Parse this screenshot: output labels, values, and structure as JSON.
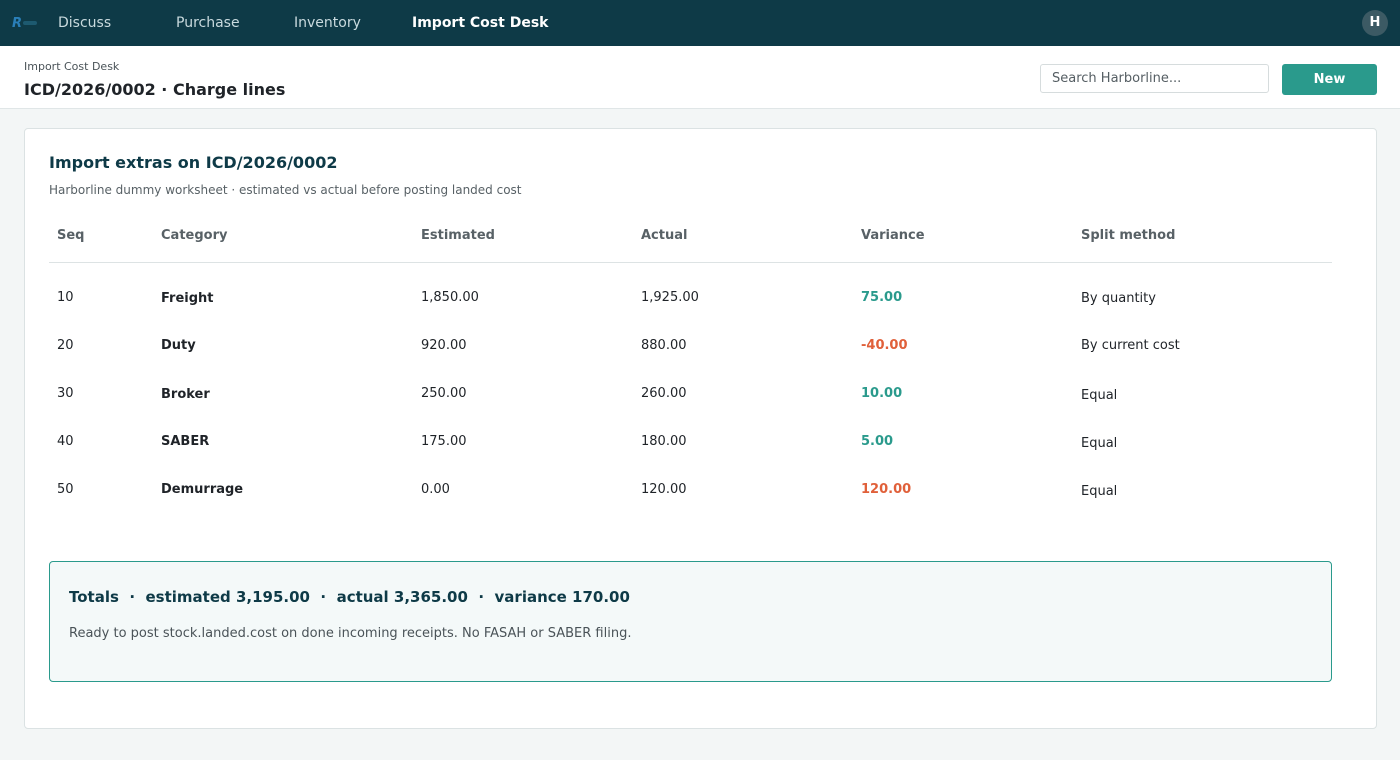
{
  "nav": {
    "items": [
      "Discuss",
      "Purchase",
      "Inventory",
      "Import Cost Desk"
    ],
    "active": "Import Cost Desk",
    "avatar_initial": "H"
  },
  "header": {
    "breadcrumb": "Import Cost Desk",
    "title": "ICD/2026/0002 · Charge lines",
    "search_placeholder": "Search Harborline...",
    "new_label": "New"
  },
  "card": {
    "title": "Import extras on ICD/2026/0002",
    "subtitle": "Harborline dummy worksheet  ·  estimated vs actual before posting landed cost",
    "columns": [
      "Seq",
      "Category",
      "Estimated",
      "Actual",
      "Variance",
      "Split method"
    ],
    "rows": [
      {
        "seq": "10",
        "category": "Freight",
        "estimated": "1,850.00",
        "actual": "1,925.00",
        "variance": "75.00",
        "split": "By quantity"
      },
      {
        "seq": "20",
        "category": "Duty",
        "estimated": "920.00",
        "actual": "880.00",
        "variance": "-40.00",
        "split": "By current cost"
      },
      {
        "seq": "30",
        "category": "Broker",
        "estimated": "250.00",
        "actual": "260.00",
        "variance": "10.00",
        "split": "Equal"
      },
      {
        "seq": "40",
        "category": "SABER",
        "estimated": "175.00",
        "actual": "180.00",
        "variance": "5.00",
        "split": "Equal"
      },
      {
        "seq": "50",
        "category": "Demurrage",
        "estimated": "0.00",
        "actual": "120.00",
        "variance": "120.00",
        "split": "Equal"
      }
    ],
    "totals": {
      "line": "Totals  ·  estimated 3,195.00  ·  actual 3,365.00  ·  variance 170.00",
      "note": "Ready to post stock.landed.cost on done incoming receipts. No FASAH or SABER filing."
    }
  },
  "colors": {
    "nav_bg": "#0e3a47",
    "accent": "#2a9a8c",
    "negative": "#e0603a",
    "page_bg": "#f3f6f6"
  }
}
